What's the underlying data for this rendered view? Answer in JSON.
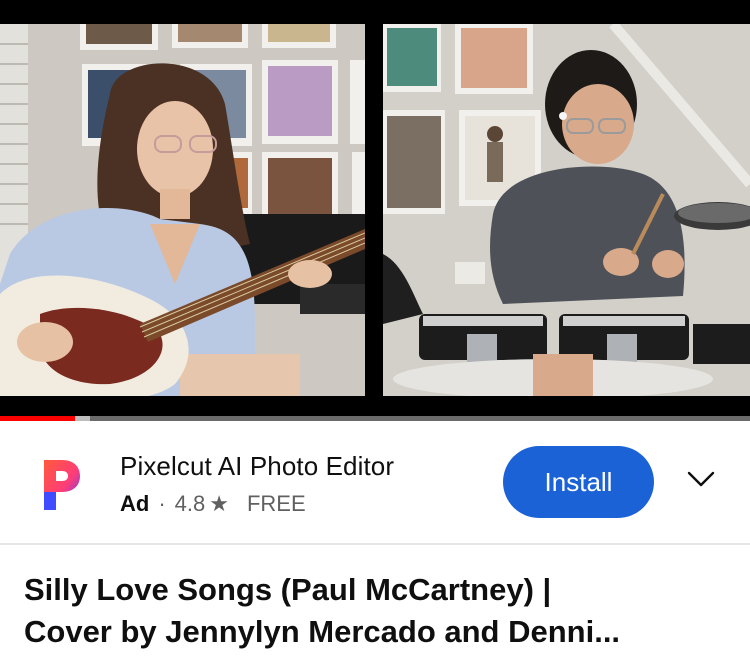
{
  "ad": {
    "app_name": "Pixelcut AI Photo Editor",
    "badge": "Ad",
    "separator": "·",
    "rating": "4.8",
    "star": "★",
    "price": "FREE",
    "install_label": "Install",
    "icons": {
      "logo": "pixelcut-logo",
      "expand": "chevron-down-icon"
    },
    "install_color": "#1a62d6"
  },
  "video": {
    "progress_played_fraction": 0.1,
    "progress_buffered_fraction": 0.12
  },
  "video_title": {
    "line1": "Silly Love Songs (Paul McCartney) |",
    "line2": "Cover by Jennylyn Mercado and Denni..."
  }
}
